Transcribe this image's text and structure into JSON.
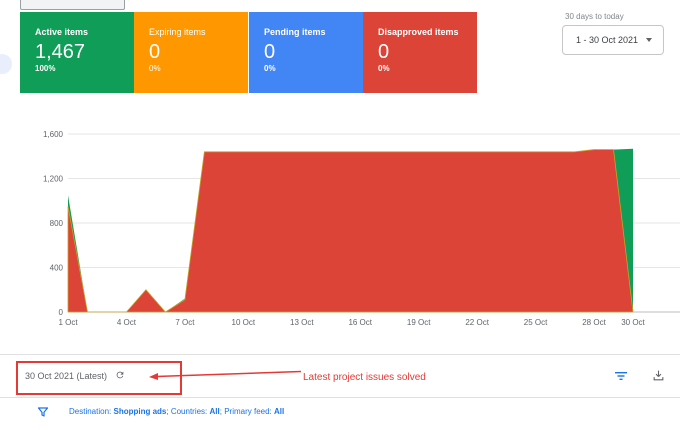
{
  "cards": [
    {
      "title": "Active items",
      "value": "1,467",
      "pct": "100%",
      "color": "#0f9d58"
    },
    {
      "title": "Expiring items",
      "value": "0",
      "pct": "0%",
      "color": "#ff9800"
    },
    {
      "title": "Pending items",
      "value": "0",
      "pct": "0%",
      "color": "#4285f4"
    },
    {
      "title": "Disapproved items",
      "value": "0",
      "pct": "0%",
      "color": "#db4437"
    }
  ],
  "date_range": {
    "caption": "30 days to today",
    "value": "1 - 30 Oct 2021"
  },
  "chart_data": {
    "type": "area",
    "x": [
      "1 Oct",
      "2 Oct",
      "3 Oct",
      "4 Oct",
      "5 Oct",
      "6 Oct",
      "7 Oct",
      "8 Oct",
      "9 Oct",
      "10 Oct",
      "11 Oct",
      "12 Oct",
      "13 Oct",
      "14 Oct",
      "15 Oct",
      "16 Oct",
      "17 Oct",
      "18 Oct",
      "19 Oct",
      "20 Oct",
      "21 Oct",
      "22 Oct",
      "23 Oct",
      "24 Oct",
      "25 Oct",
      "26 Oct",
      "27 Oct",
      "28 Oct",
      "29 Oct",
      "30 Oct"
    ],
    "tick_labels": [
      "1 Oct",
      "4 Oct",
      "7 Oct",
      "10 Oct",
      "13 Oct",
      "16 Oct",
      "19 Oct",
      "22 Oct",
      "25 Oct",
      "28 Oct",
      "30 Oct"
    ],
    "ylim": [
      0,
      1600
    ],
    "yticks": [
      "0",
      "400",
      "800",
      "1,200",
      "1,600"
    ],
    "series": [
      {
        "color": "#0f9d58",
        "values": [
          1050,
          0,
          0,
          0,
          200,
          0,
          120,
          1440,
          1440,
          1440,
          1440,
          1440,
          1440,
          1440,
          1440,
          1440,
          1440,
          1440,
          1440,
          1440,
          1440,
          1440,
          1440,
          1440,
          1440,
          1440,
          1440,
          1460,
          1460,
          1467
        ]
      },
      {
        "color": "#db4437",
        "values": [
          950,
          0,
          0,
          0,
          200,
          0,
          110,
          1440,
          1440,
          1440,
          1440,
          1440,
          1440,
          1440,
          1440,
          1440,
          1440,
          1440,
          1440,
          1440,
          1440,
          1440,
          1440,
          1440,
          1440,
          1440,
          1440,
          1460,
          1460,
          0
        ]
      }
    ],
    "grid": true
  },
  "status": {
    "text": "30 Oct 2021 (Latest)"
  },
  "annotation": {
    "text": "Latest project issues solved"
  },
  "footer": {
    "dest_label": "Destination:",
    "dest_value": "Shopping ads",
    "countries_label": "; Countries:",
    "countries_value": "All",
    "feed_label": "; Primary feed:",
    "feed_value": "All"
  }
}
